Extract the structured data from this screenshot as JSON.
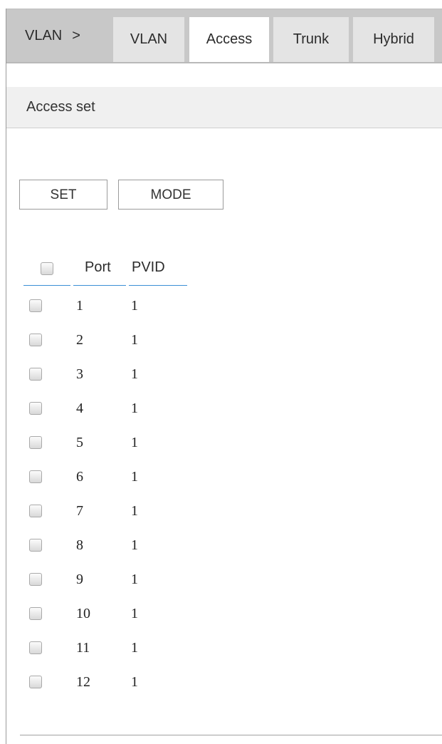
{
  "breadcrumb": {
    "root": "VLAN",
    "separator": ">"
  },
  "tabs": [
    {
      "label": "VLAN",
      "active": false
    },
    {
      "label": "Access",
      "active": true
    },
    {
      "label": "Trunk",
      "active": false
    },
    {
      "label": "Hybrid",
      "active": false
    }
  ],
  "section": {
    "title": "Access set"
  },
  "buttons": {
    "set": "SET",
    "mode": "MODE"
  },
  "table": {
    "headers": {
      "port": "Port",
      "pvid": "PVID"
    },
    "rows": [
      {
        "port": "1",
        "pvid": "1"
      },
      {
        "port": "2",
        "pvid": "1"
      },
      {
        "port": "3",
        "pvid": "1"
      },
      {
        "port": "4",
        "pvid": "1"
      },
      {
        "port": "5",
        "pvid": "1"
      },
      {
        "port": "6",
        "pvid": "1"
      },
      {
        "port": "7",
        "pvid": "1"
      },
      {
        "port": "8",
        "pvid": "1"
      },
      {
        "port": "9",
        "pvid": "1"
      },
      {
        "port": "10",
        "pvid": "1"
      },
      {
        "port": "11",
        "pvid": "1"
      },
      {
        "port": "12",
        "pvid": "1"
      }
    ]
  },
  "colors": {
    "header_bg": "#c8c8c8",
    "active_tab": "#ffffff",
    "inactive_tab": "#e4e4e4",
    "accent_underline": "#3b8fd6"
  }
}
